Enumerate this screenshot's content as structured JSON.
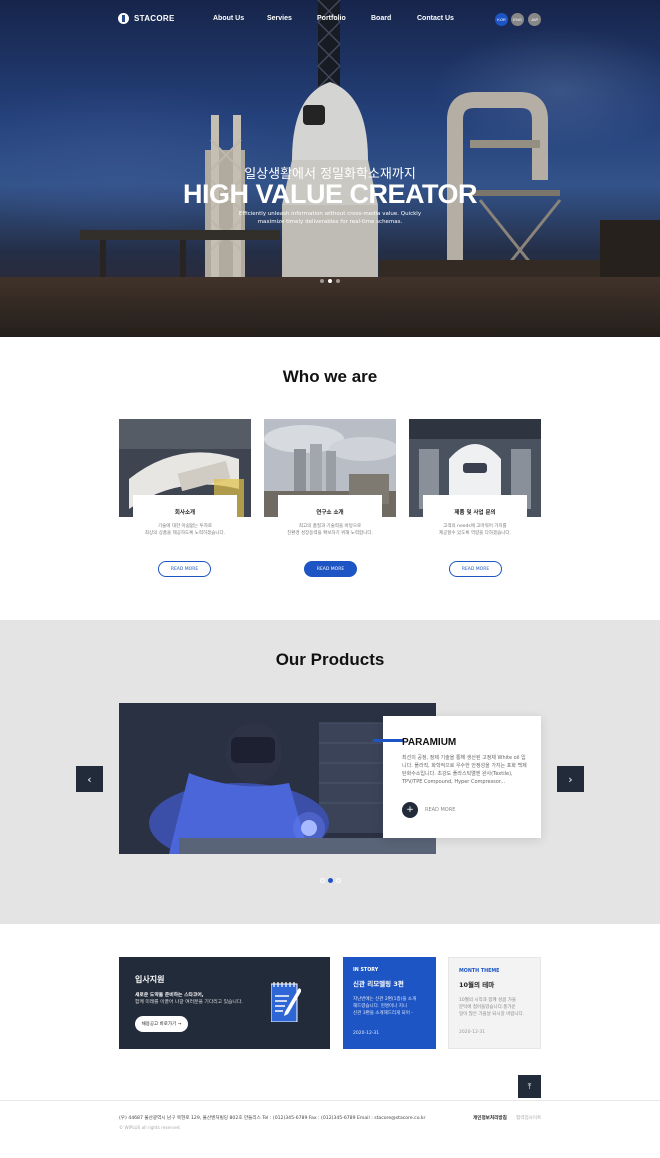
{
  "brand": {
    "logo_text": "STACORE"
  },
  "nav": {
    "items": [
      "About Us",
      "Servies",
      "Portfolio",
      "Board",
      "Contact Us"
    ],
    "langs": [
      {
        "label": "KOR",
        "color": "#1d55c4"
      },
      {
        "label": "ENG",
        "color": "#888888"
      },
      {
        "label": "JAP",
        "color": "#888888"
      }
    ]
  },
  "hero": {
    "subtitle": "일상생활에서 정밀화학소재까지",
    "title": "HIGH VALUE CREATOR",
    "desc_line1": "Efficiently unleash information without cross-media value. Quickly",
    "desc_line2": "maximize timely deliverables for real-time schemas.",
    "slide_count": 3,
    "active_slide": 1
  },
  "who": {
    "title": "Who we are",
    "cards": [
      {
        "title": "회사소개",
        "desc1": "기술에 대한 아쉽없는 투자로",
        "desc2": "최상의 상품을 제공하도록 노력하겠습니다.",
        "button": "READ MORE",
        "style": "outline"
      },
      {
        "title": "연구소 소개",
        "desc1": "최고의 품질과 기술력을 바탕으로",
        "desc2": "친환경 성장동력을 확보하기 위해 노력합니다.",
        "button": "READ MORE",
        "style": "solid"
      },
      {
        "title": "제품 및 사업 문의",
        "desc1": "고객의 needs에 고마워어 가치를",
        "desc2": "제공할수 있도록 역량을 다하겠습니다.",
        "button": "READ MORE",
        "style": "outline"
      }
    ]
  },
  "products": {
    "title": "Our Products",
    "name": "PARAMIUM",
    "desc": "최선의 공정, 정제 기술을 통해 생산된 고정제 White oil 입니다. 플라직, 화학적으로 우수한 안정성을 가지는 포화 백제 탄화수소입니다. 초강도 플라스틱앨엔 완사(Textile), TPV/TPE Compound, Hyper Compressor...",
    "more_label": "READ MORE",
    "prev_icon": "chevron-left-icon",
    "next_icon": "chevron-right-icon",
    "slide_count": 3,
    "active_slide": 1
  },
  "recruit": {
    "title": "입사지원",
    "desc_bold": "새로운 도약을 준비하는 스타코어,",
    "desc": "함께 미래를 이끌어 나갈 여러분을 기다리고 있습니다.",
    "button": "채용공고 바로가기 →"
  },
  "stories": [
    {
      "tag": "IN STORY",
      "title": "신관 리모델링 3편",
      "text1": "지난번에는 신관 2편(1층)을 소개",
      "text2": "해드렸습니다. 현명이나 지니",
      "text3": "신관 3편을 소개해드리게 되어 -",
      "date": "2020-12-31"
    },
    {
      "tag": "MONTH THEME",
      "title": "10월의 테마",
      "text1": "10월의 시작과 함께 성큼 가을",
      "text2": "문턱에 접어들었습니다.풍가운",
      "text3": "일이 많은 가을날 되시길 바랍니다.",
      "date": "2020-12-31"
    }
  ],
  "top_button_icon": "arrow-up-icon",
  "footer": {
    "address": "(우) 44687 울산광역시 남구 북현로 129, 울산벤처빌딩 802호 만들리스      Tel : (012)345-6789      Fax : (012)345-6789      Email : stacore@stacore.co.kr",
    "copyright": "© WIPLUS all rights reserved.",
    "link1": "개인정보처리방침",
    "link2": "협력업사이트"
  }
}
